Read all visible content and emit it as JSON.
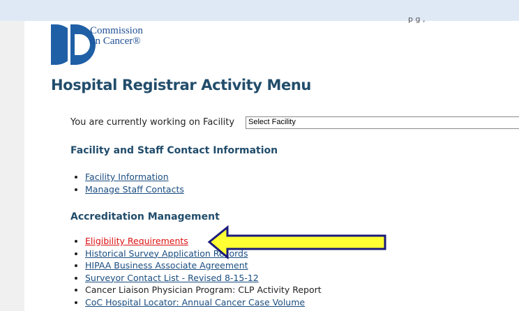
{
  "top_cut_text": "p       g ,",
  "logo": {
    "line1": "Commission",
    "line2": "on Cancer®"
  },
  "page_title": "Hospital Registrar Activity Menu",
  "facility": {
    "prompt": "You are currently working on Facility",
    "select_value": "Select Facility"
  },
  "section1": {
    "heading": "Facility and Staff Contact Information",
    "links": [
      "Facility Information",
      "Manage Staff Contacts"
    ]
  },
  "section2": {
    "heading": "Accreditation Management",
    "links": [
      "Eligibility Requirements",
      "Historical Survey Application Records",
      "HIPAA Business Associate Agreement",
      "Surveyor Contact List - Revised 8-15-12",
      "Cancer Liaison Physician Program: CLP Activity Report",
      "CoC Hospital Locator: Annual Cancer Case Volume"
    ]
  },
  "colors": {
    "arrow_fill": "#ffff33",
    "arrow_stroke": "#1a1a7a",
    "link": "#1a4d80",
    "active_link": "#dd1111",
    "heading": "#224d6b"
  },
  "icons": {
    "annotation_arrow": "left-pointing-arrow-icon"
  }
}
